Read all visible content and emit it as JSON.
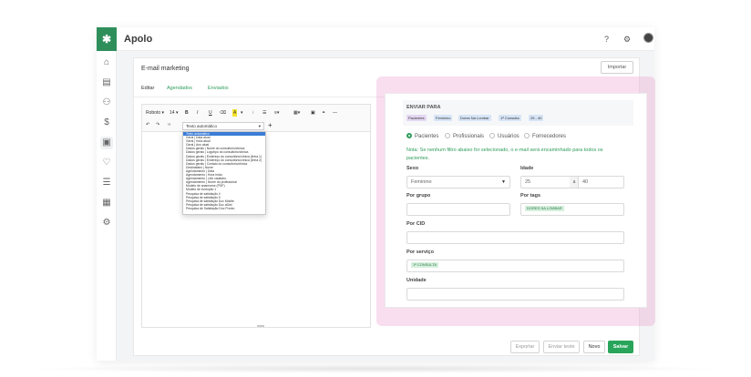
{
  "app": {
    "title": "Apolo",
    "logo_glyph": "✱"
  },
  "topbar": {
    "help_icon": "?",
    "settings_icon": "⚙"
  },
  "sidebar": {
    "icons": [
      "home-icon",
      "calendar-icon",
      "users-icon",
      "money-icon",
      "briefcase-icon",
      "heart-icon",
      "list-icon",
      "table-icon",
      "gear-icon"
    ]
  },
  "page": {
    "title": "E-mail marketing",
    "import_label": "Importar",
    "tabs": [
      {
        "label": "Editar"
      },
      {
        "label": "Agendados"
      },
      {
        "label": "Enviados"
      }
    ]
  },
  "editor": {
    "font_select": "Roboto",
    "font_size": "14",
    "bold": "B",
    "italic": "I",
    "underline": "U",
    "eraser": "⌫",
    "highlight": "A",
    "ordered_list": "⁝",
    "bullet_list": "☰",
    "align": "≡",
    "table": "▦",
    "image": "▣",
    "link": "⚭",
    "hr": "—",
    "undo": "↶",
    "redo": "↷",
    "code": "‹›",
    "auto_text_select": "Texto automático",
    "plus": "+",
    "dropdown_items": [
      "Texto automático",
      "Geral | Data atual",
      "Geral | Hora atual",
      "Geral | Ano atual",
      "Dados gerais | Nome do consultório/clínica",
      "Dados gerais | Logotipo do consultório/clínica",
      "Dados gerais | Endereço do consultório/clínica (linha 1)",
      "Dados gerais | Endereço do consultório/clínica (linha 2)",
      "Dados gerais | Contato do consultório/clínica",
      "Destinatário | Nome",
      "Agendamento | Data",
      "Agendamento | Hora início",
      "Agendamento | Link cadastro",
      "Agendamento | Nome do profissional",
      "Modelo de anamnese (PDF)",
      "Modelo de evolução 1",
      "Pesquisa de satisfação 4",
      "Pesquisa de satisfação 5",
      "Pesquisa de satisfação Doc Mobile",
      "Pesquisa de satisfação Doc aDist",
      "Pesquisa de Satisfação Doc Pronto"
    ]
  },
  "filter": {
    "title": "ENVIAR PARA",
    "chips": [
      "Pacientes",
      "Feminino",
      "Dores Na Lombar",
      "1ª Consulta",
      "25 - 40"
    ],
    "radios": [
      {
        "label": "Pacientes",
        "checked": true
      },
      {
        "label": "Profissionais",
        "checked": false
      },
      {
        "label": "Usuários",
        "checked": false
      },
      {
        "label": "Fornecedores",
        "checked": false
      }
    ],
    "note": "Nota: Se nenhum filtro abaixo for selecionado, o e-mail será encaminhado para todos os pacientes.",
    "sexo_label": "Sexo",
    "sexo_value": "Feminino",
    "idade_label": "Idade",
    "idade_min": "25",
    "idade_sep": "a",
    "idade_max": "40",
    "grupo_label": "Por grupo",
    "grupo_value": "",
    "tags_label": "Por tags",
    "tags_value": "DORES NA LOMBAR",
    "cid_label": "Por CID",
    "cid_value": "",
    "servico_label": "Por serviço",
    "servico_value": "1ª CONSULTA",
    "unidade_label": "Unidade",
    "unidade_value": ""
  },
  "footer": {
    "export_label": "Exportar",
    "send_test_label": "Enviar teste",
    "new_label": "Novo",
    "save_label": "Salvar"
  },
  "colors": {
    "brand": "#2e8f5b",
    "accent": "#28a55a",
    "highlight_overlay": "#eca0d0",
    "chip_blue": "#d7e5f7"
  }
}
